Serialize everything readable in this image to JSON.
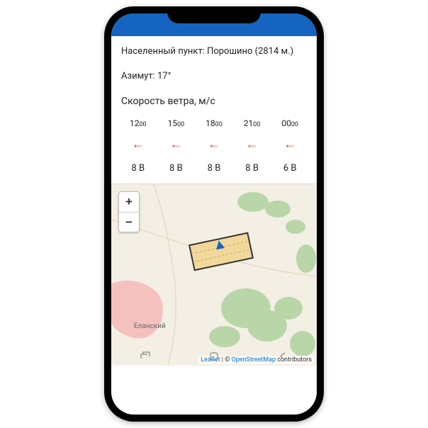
{
  "info": {
    "settlement": "Населенный пункт: Порошино (2814 м.)",
    "azimuth": "Азимут: 17°"
  },
  "wind": {
    "title": "Скорость ветра, м/с",
    "columns": [
      {
        "timeH": "12",
        "timeM": "00",
        "speed": "8",
        "dir": "В"
      },
      {
        "timeH": "15",
        "timeM": "00",
        "speed": "8",
        "dir": "В"
      },
      {
        "timeH": "18",
        "timeM": "00",
        "speed": "8",
        "dir": "В"
      },
      {
        "timeH": "21",
        "timeM": "00",
        "speed": "8",
        "dir": "В"
      },
      {
        "timeH": "00",
        "timeM": "00",
        "speed": "6",
        "dir": "В"
      }
    ]
  },
  "map": {
    "zoom_in": "+",
    "zoom_out": "−",
    "place_label": "Еланский",
    "attribution_leaflet": "Leaflet",
    "attribution_sep": " | © ",
    "attribution_osm": "OpenStreetMap",
    "attribution_tail": " contributors"
  }
}
